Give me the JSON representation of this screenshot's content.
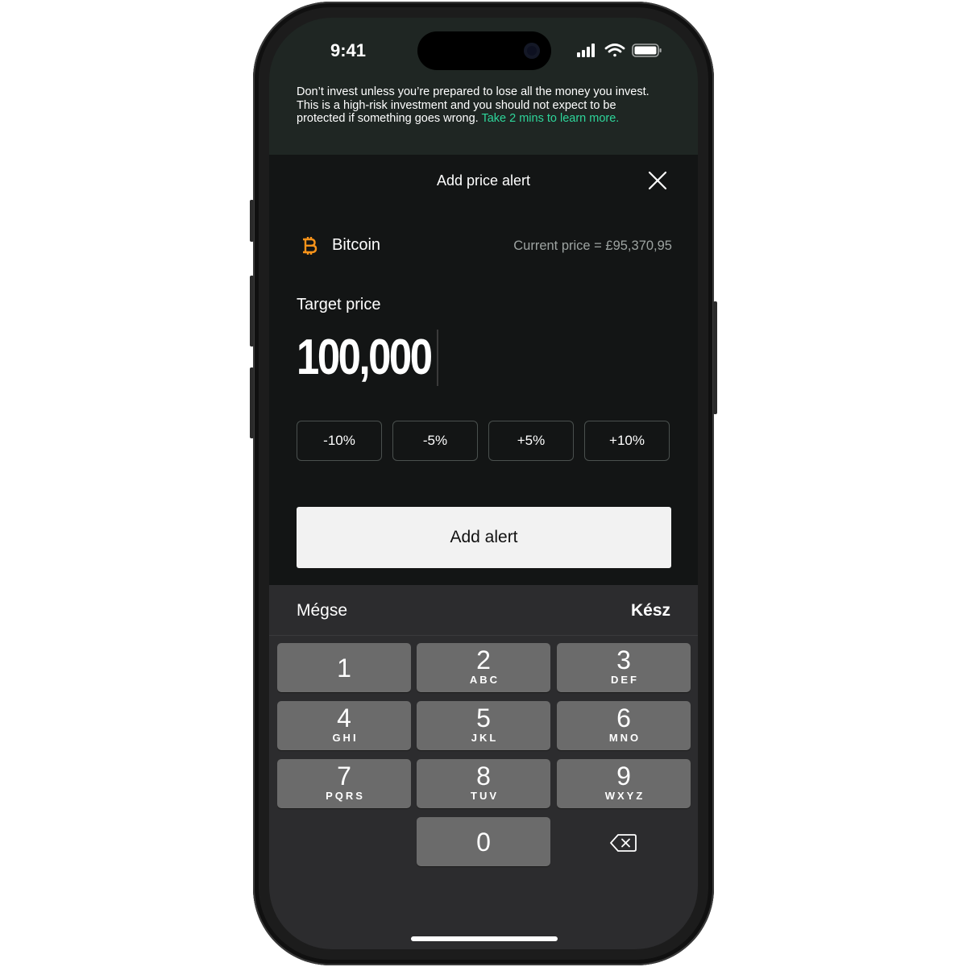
{
  "status_bar": {
    "time": "9:41"
  },
  "risk_warning": {
    "text": "Don’t invest unless you’re prepared to lose all the money you invest. This is a high-risk investment and you should not expect to be protected if something goes wrong. ",
    "link_text": "Take 2 mins to learn more."
  },
  "sheet": {
    "title": "Add price alert"
  },
  "asset": {
    "name": "Bitcoin",
    "current_price": "Current price = £95,370,95",
    "icon": "bitcoin-icon"
  },
  "target": {
    "label": "Target price",
    "value": "100,000"
  },
  "percent_buttons": [
    {
      "label": "-10%"
    },
    {
      "label": "-5%"
    },
    {
      "label": "+5%"
    },
    {
      "label": "+10%"
    }
  ],
  "add_alert_label": "Add alert",
  "keyboard_toolbar": {
    "cancel_label": "Mégse",
    "done_label": "Kész"
  },
  "keypad": {
    "k1": {
      "digit": "1",
      "letters": ""
    },
    "k2": {
      "digit": "2",
      "letters": "ABC"
    },
    "k3": {
      "digit": "3",
      "letters": "DEF"
    },
    "k4": {
      "digit": "4",
      "letters": "GHI"
    },
    "k5": {
      "digit": "5",
      "letters": "JKL"
    },
    "k6": {
      "digit": "6",
      "letters": "MNO"
    },
    "k7": {
      "digit": "7",
      "letters": "PQRS"
    },
    "k8": {
      "digit": "8",
      "letters": "TUV"
    },
    "k9": {
      "digit": "9",
      "letters": "WXYZ"
    },
    "k0": {
      "digit": "0",
      "letters": ""
    }
  },
  "colors": {
    "accent_link": "#2ed59a",
    "bitcoin_orange": "#f7931a"
  }
}
